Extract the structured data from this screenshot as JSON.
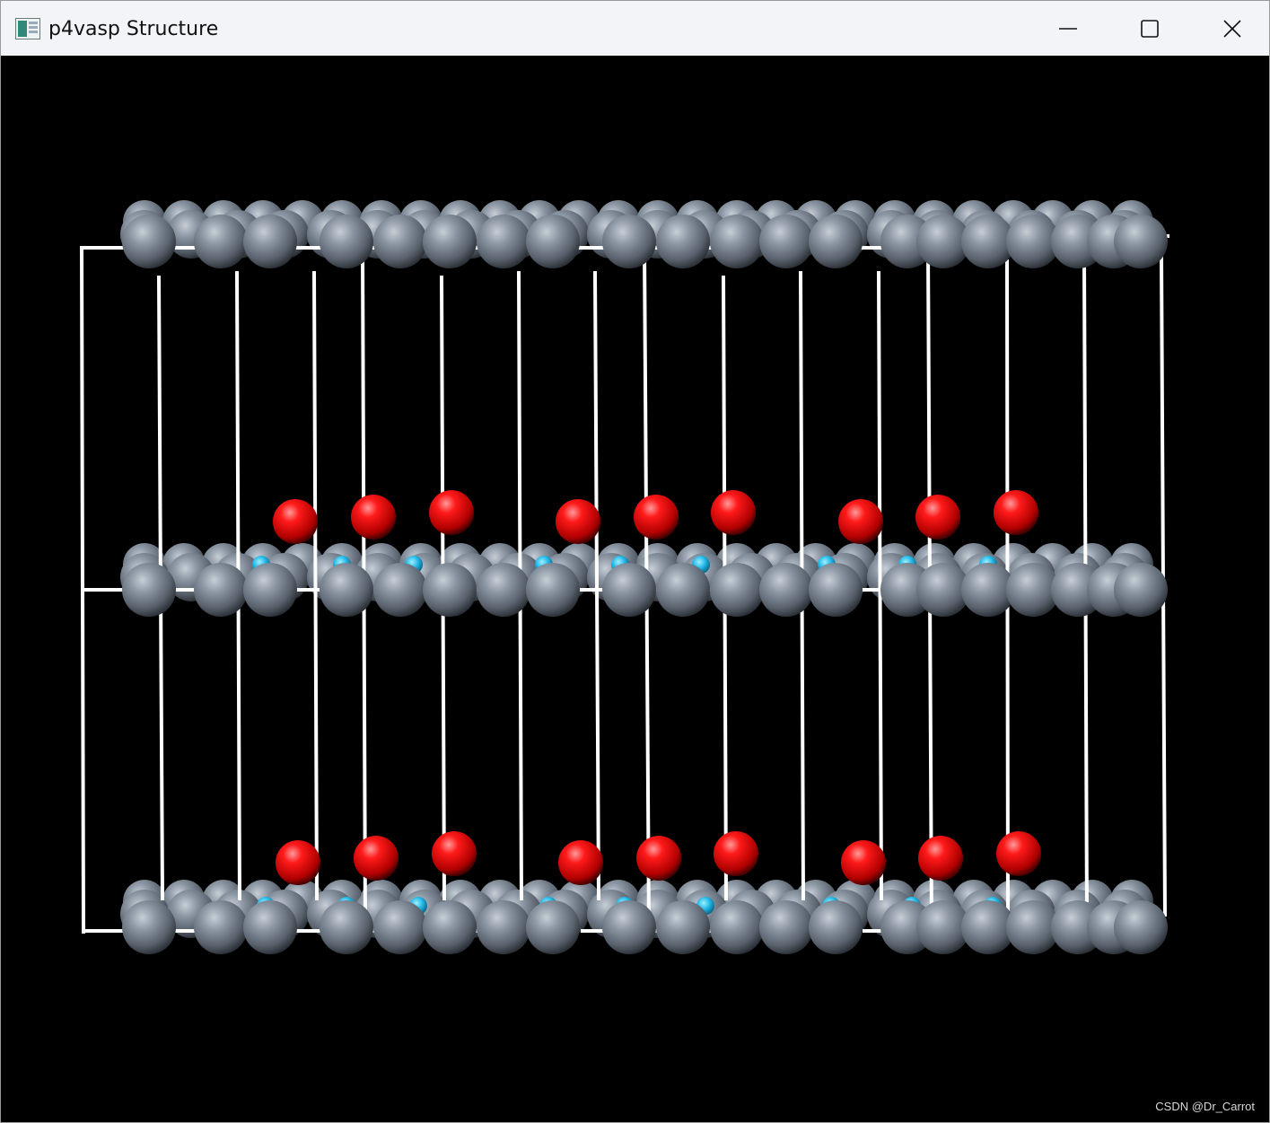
{
  "window": {
    "title": "p4vasp Structure",
    "controls": {
      "minimize_icon": "minimize-icon",
      "maximize_icon": "maximize-icon",
      "close_icon": "close-icon"
    }
  },
  "viewer": {
    "background_color": "#000000",
    "cell_edge_color": "#ffffff",
    "atom_colors": {
      "carbon_gray": "#6c7784",
      "oxygen_red": "#e00000",
      "nitrogen_blue": "#1fb6e6"
    },
    "watermark": "CSDN @Dr_Carrot"
  }
}
